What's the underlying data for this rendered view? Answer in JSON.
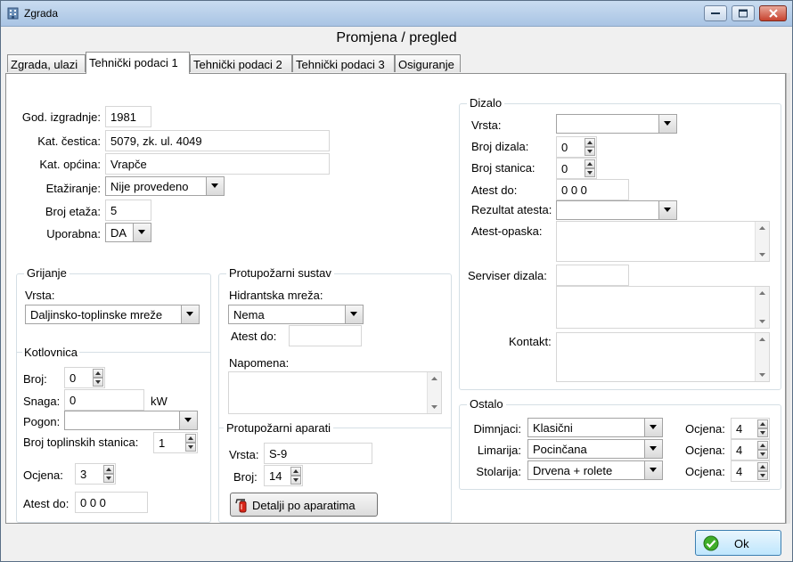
{
  "window": {
    "title": "Zgrada",
    "dialog_title": "Promjena / pregled"
  },
  "tabs": [
    {
      "label": "Zgrada, ulazi"
    },
    {
      "label": "Tehnički podaci 1"
    },
    {
      "label": "Tehnički podaci 2"
    },
    {
      "label": "Tehnički podaci 3"
    },
    {
      "label": "Osiguranje"
    }
  ],
  "building": {
    "god_izgradnje": {
      "label": "God. izgradnje:",
      "value": "1981"
    },
    "kat_cestica": {
      "label": "Kat. čestica:",
      "value": "5079, zk. ul. 4049"
    },
    "kat_opcina": {
      "label": "Kat. općina:",
      "value": "Vrapče"
    },
    "etaziranje": {
      "label": "Etažiranje:",
      "value": "Nije provedeno"
    },
    "broj_etaza": {
      "label": "Broj etaža:",
      "value": "5"
    },
    "uporabna": {
      "label": "Uporabna:",
      "value": "DA"
    }
  },
  "grijanje": {
    "legend": "Grijanje",
    "vrsta_label": "Vrsta:",
    "vrsta_value": "Daljinsko-toplinske mreže",
    "kotlovnica_legend": "Kotlovnica",
    "broj_label": "Broj:",
    "broj_value": "0",
    "snaga_label": "Snaga:",
    "snaga_value": "0",
    "snaga_unit": "kW",
    "pogon_label": "Pogon:",
    "pogon_value": "",
    "stanica_label": "Broj toplinskih stanica:",
    "stanica_value": "1",
    "ocjena_label": "Ocjena:",
    "ocjena_value": "3",
    "atest_label": "Atest do:",
    "atest_value": "0 0  0"
  },
  "protupozarni": {
    "legend": "Protupožarni sustav",
    "hidrant_label": "Hidrantska mreža:",
    "hidrant_value": "Nema",
    "atest_label": "Atest do:",
    "atest_value": "",
    "napomena_label": "Napomena:",
    "aparati_legend": "Protupožarni aparati",
    "vrsta_label": "Vrsta:",
    "vrsta_value": "S-9",
    "broj_label": "Broj:",
    "broj_value": "14",
    "detalji_button": "Detalji po aparatima"
  },
  "dizalo": {
    "legend": "Dizalo",
    "vrsta_label": "Vrsta:",
    "vrsta_value": "",
    "broj_dizala_label": "Broj dizala:",
    "broj_dizala_value": "0",
    "broj_stanica_label": "Broj stanica:",
    "broj_stanica_value": "0",
    "atest_label": "Atest do:",
    "atest_value": "0 0  0",
    "rezultat_label": "Rezultat atesta:",
    "rezultat_value": "",
    "opaska_label": "Atest-opaska:",
    "serviser_label": "Serviser dizala:",
    "serviser_value": "",
    "kontakt_label": "Kontakt:"
  },
  "ostalo": {
    "legend": "Ostalo",
    "ocjena_label": "Ocjena:",
    "rows": [
      {
        "label": "Dimnjaci:",
        "value": "Klasični",
        "ocjena": "4"
      },
      {
        "label": "Limarija:",
        "value": "Pocinčana",
        "ocjena": "4"
      },
      {
        "label": "Stolarija:",
        "value": "Drvena + rolete",
        "ocjena": "4"
      }
    ]
  },
  "ok_button": "Ok"
}
